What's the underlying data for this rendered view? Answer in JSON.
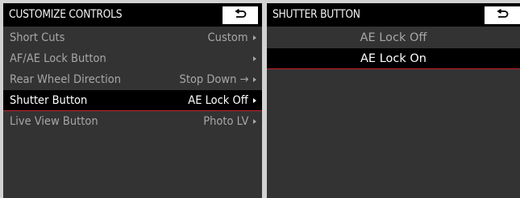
{
  "left_panel": {
    "title": "CUSTOMIZE CONTROLS",
    "back_icon": "return-arrow-icon",
    "items": [
      {
        "label": "Short Cuts",
        "value": "Custom",
        "arrow": ""
      },
      {
        "label": "AF/AE Lock Button",
        "value": "",
        "arrow": ""
      },
      {
        "label": "Rear Wheel Direction",
        "value": "Stop Down",
        "arrow": "→"
      },
      {
        "label": "Shutter Button",
        "value": "AE Lock Off",
        "arrow": "",
        "selected": true
      },
      {
        "label": "Live View Button",
        "value": "Photo LV",
        "arrow": ""
      }
    ]
  },
  "right_panel": {
    "title": "SHUTTER BUTTON",
    "back_icon": "return-arrow-icon",
    "options": [
      {
        "label": "AE Lock Off"
      },
      {
        "label": "AE Lock On",
        "selected": true
      }
    ]
  },
  "colors": {
    "highlight_underline": "#c8242b",
    "background": "#333333",
    "header": "#000000"
  }
}
